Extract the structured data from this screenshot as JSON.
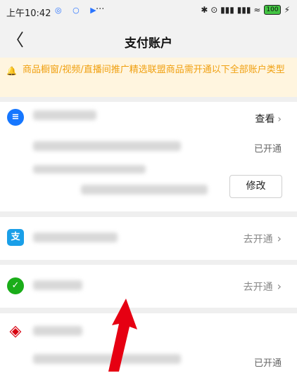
{
  "status_bar": {
    "time": "上午10:42",
    "app_icons": "◎ ○ ▶",
    "dots": "···",
    "right_icons": "✱ ⊙ ▮▮▮ ▮▮▮ ≈",
    "battery": "100"
  },
  "header": {
    "back_glyph": "〈",
    "title": "支付账户"
  },
  "notice": {
    "icon": "bell",
    "text": "商品橱窗/视频/直播间推广精选联盟商品需开通以下全部账户类型"
  },
  "accounts": [
    {
      "icon": "douyin-pay",
      "action_label": "查看",
      "status": "已开通",
      "button": "修改"
    },
    {
      "icon": "alipay",
      "action_label": "去开通"
    },
    {
      "icon": "wechat-pay",
      "action_label": "去开通"
    },
    {
      "icon": "unionpay",
      "status": "已开通"
    }
  ],
  "colors": {
    "notice_bg": "#fff5df",
    "notice_text": "#f0a010",
    "arrow": "#e60012"
  }
}
